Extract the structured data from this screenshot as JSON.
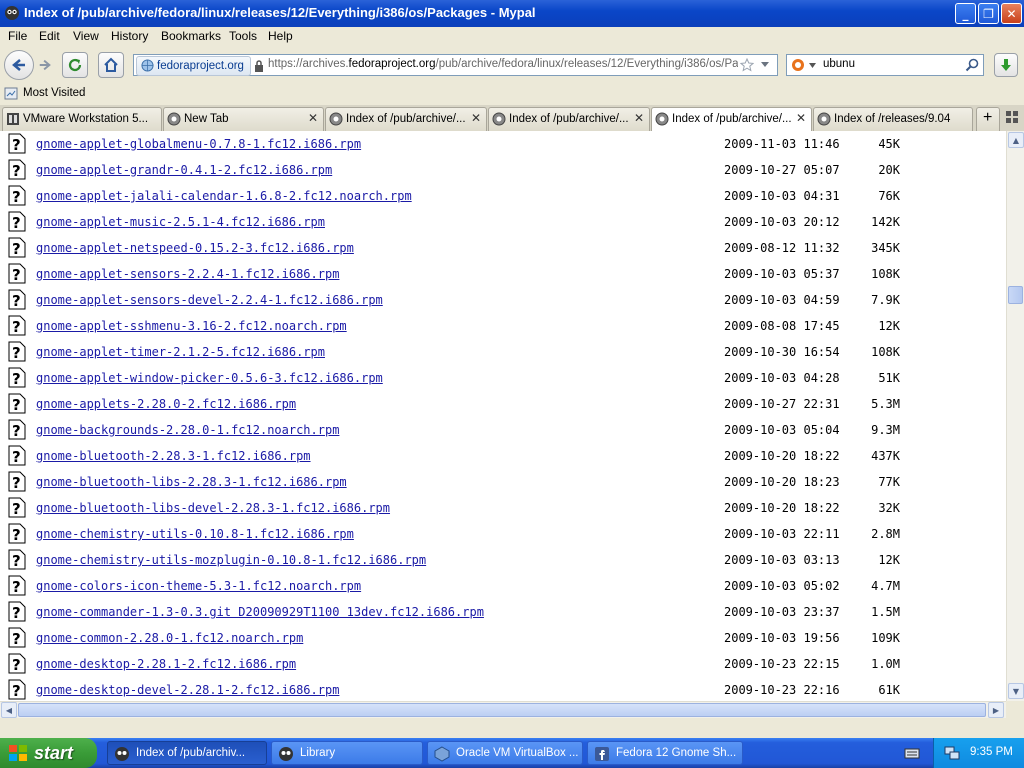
{
  "window": {
    "title": "Index of /pub/archive/fedora/linux/releases/12/Everything/i386/os/Packages - Mypal"
  },
  "menu": [
    "File",
    "Edit",
    "View",
    "History",
    "Bookmarks",
    "Tools",
    "Help"
  ],
  "nav": {
    "identity": "fedoraproject.org",
    "url_prefix": "https://archives.",
    "url_domain": "fedoraproject.org",
    "url_path": "/pub/archive/fedora/linux/releases/12/Everything/i386/os/Pac",
    "search_value": "ubunu"
  },
  "bookmarks": {
    "most_visited": "Most Visited"
  },
  "tabs": [
    {
      "label": "VMware Workstation 5...",
      "active": false
    },
    {
      "label": "New Tab",
      "active": false
    },
    {
      "label": "Index of /pub/archive/...",
      "active": false
    },
    {
      "label": "Index of /pub/archive/...",
      "active": false
    },
    {
      "label": "Index of /pub/archive/...",
      "active": true
    },
    {
      "label": "Index of /releases/9.04",
      "active": false
    }
  ],
  "files": [
    {
      "name": "gnome-applet-globalmenu-0.7.8-1.fc12.i686.rpm",
      "date": "2009-11-03 11:46",
      "size": "45K"
    },
    {
      "name": "gnome-applet-grandr-0.4.1-2.fc12.i686.rpm",
      "date": "2009-10-27 05:07",
      "size": "20K"
    },
    {
      "name": "gnome-applet-jalali-calendar-1.6.8-2.fc12.noarch.rpm",
      "date": "2009-10-03 04:31",
      "size": "76K"
    },
    {
      "name": "gnome-applet-music-2.5.1-4.fc12.i686.rpm",
      "date": "2009-10-03 20:12",
      "size": "142K"
    },
    {
      "name": "gnome-applet-netspeed-0.15.2-3.fc12.i686.rpm",
      "date": "2009-08-12 11:32",
      "size": "345K"
    },
    {
      "name": "gnome-applet-sensors-2.2.4-1.fc12.i686.rpm",
      "date": "2009-10-03 05:37",
      "size": "108K"
    },
    {
      "name": "gnome-applet-sensors-devel-2.2.4-1.fc12.i686.rpm",
      "date": "2009-10-03 04:59",
      "size": "7.9K"
    },
    {
      "name": "gnome-applet-sshmenu-3.16-2.fc12.noarch.rpm",
      "date": "2009-08-08 17:45",
      "size": "12K"
    },
    {
      "name": "gnome-applet-timer-2.1.2-5.fc12.i686.rpm",
      "date": "2009-10-30 16:54",
      "size": "108K"
    },
    {
      "name": "gnome-applet-window-picker-0.5.6-3.fc12.i686.rpm",
      "date": "2009-10-03 04:28",
      "size": "51K"
    },
    {
      "name": "gnome-applets-2.28.0-2.fc12.i686.rpm",
      "date": "2009-10-27 22:31",
      "size": "5.3M"
    },
    {
      "name": "gnome-backgrounds-2.28.0-1.fc12.noarch.rpm",
      "date": "2009-10-03 05:04",
      "size": "9.3M"
    },
    {
      "name": "gnome-bluetooth-2.28.3-1.fc12.i686.rpm",
      "date": "2009-10-20 18:22",
      "size": "437K"
    },
    {
      "name": "gnome-bluetooth-libs-2.28.3-1.fc12.i686.rpm",
      "date": "2009-10-20 18:23",
      "size": "77K"
    },
    {
      "name": "gnome-bluetooth-libs-devel-2.28.3-1.fc12.i686.rpm",
      "date": "2009-10-20 18:22",
      "size": "32K"
    },
    {
      "name": "gnome-chemistry-utils-0.10.8-1.fc12.i686.rpm",
      "date": "2009-10-03 22:11",
      "size": "2.8M"
    },
    {
      "name": "gnome-chemistry-utils-mozplugin-0.10.8-1.fc12.i686.rpm",
      "date": "2009-10-03 03:13",
      "size": "12K"
    },
    {
      "name": "gnome-colors-icon-theme-5.3-1.fc12.noarch.rpm",
      "date": "2009-10-03 05:02",
      "size": "4.7M"
    },
    {
      "name": "gnome-commander-1.3-0.3.git D20090929T1100 13dev.fc12.i686.rpm",
      "date": "2009-10-03 23:37",
      "size": "1.5M"
    },
    {
      "name": "gnome-common-2.28.0-1.fc12.noarch.rpm",
      "date": "2009-10-03 19:56",
      "size": "109K"
    },
    {
      "name": "gnome-desktop-2.28.1-2.fc12.i686.rpm",
      "date": "2009-10-23 22:15",
      "size": "1.0M"
    },
    {
      "name": "gnome-desktop-devel-2.28.1-2.fc12.i686.rpm",
      "date": "2009-10-23 22:16",
      "size": "61K"
    }
  ],
  "taskbar": {
    "start": "start",
    "tasks": [
      {
        "label": "Index of /pub/archiv...",
        "active": true
      },
      {
        "label": "Library",
        "active": false
      },
      {
        "label": "Oracle VM VirtualBox ...",
        "active": false
      },
      {
        "label": "Fedora 12 Gnome Sh...",
        "active": false
      }
    ],
    "clock": "9:35 PM"
  }
}
